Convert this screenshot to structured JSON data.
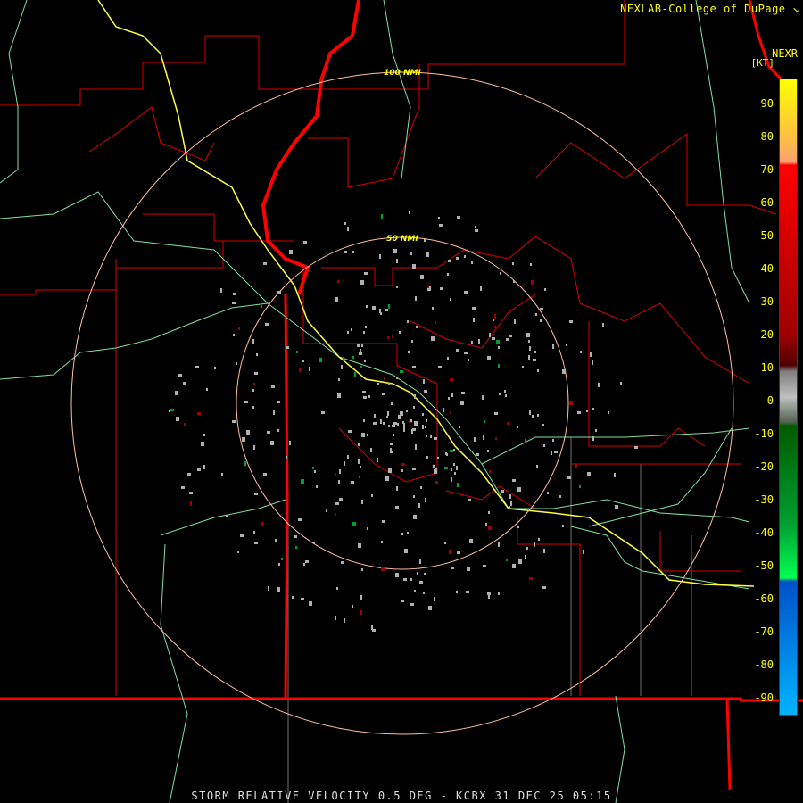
{
  "header": {
    "credit": "NEXLAB-College of DuPage",
    "credit_icon": "logo-mark-icon",
    "product": "NEXR",
    "units": "[KT]"
  },
  "range_rings": [
    {
      "label": "50 NMI",
      "nmi": 50
    },
    {
      "label": "100 NMI",
      "nmi": 100
    }
  ],
  "legend": {
    "ticks": [
      "90",
      "80",
      "70",
      "60",
      "50",
      "40",
      "30",
      "20",
      "10",
      "0",
      "-10",
      "-20",
      "-30",
      "-40",
      "-50",
      "-60",
      "-70",
      "-80",
      "-90"
    ],
    "colors": {
      "inbound_high": "#00b4ff",
      "inbound_mid": "#0050c8",
      "green_high": "#00ff50",
      "green_low": "#005a00",
      "zero": "#c0c0c0",
      "red_low": "#500000",
      "red_high": "#ff0000",
      "salmon": "#ffa070",
      "yellow": "#ffff00"
    }
  },
  "caption": "STORM RELATIVE VELOCITY 0.5 DEG - KCBX 31 DEC 25 05:15",
  "colors": {
    "state_border": "#ff0000",
    "county_border": "#e00000",
    "highway": "#80e0a0",
    "interstate": "#ffff40",
    "ring": "#ffc0a0",
    "grid": "#808080"
  }
}
